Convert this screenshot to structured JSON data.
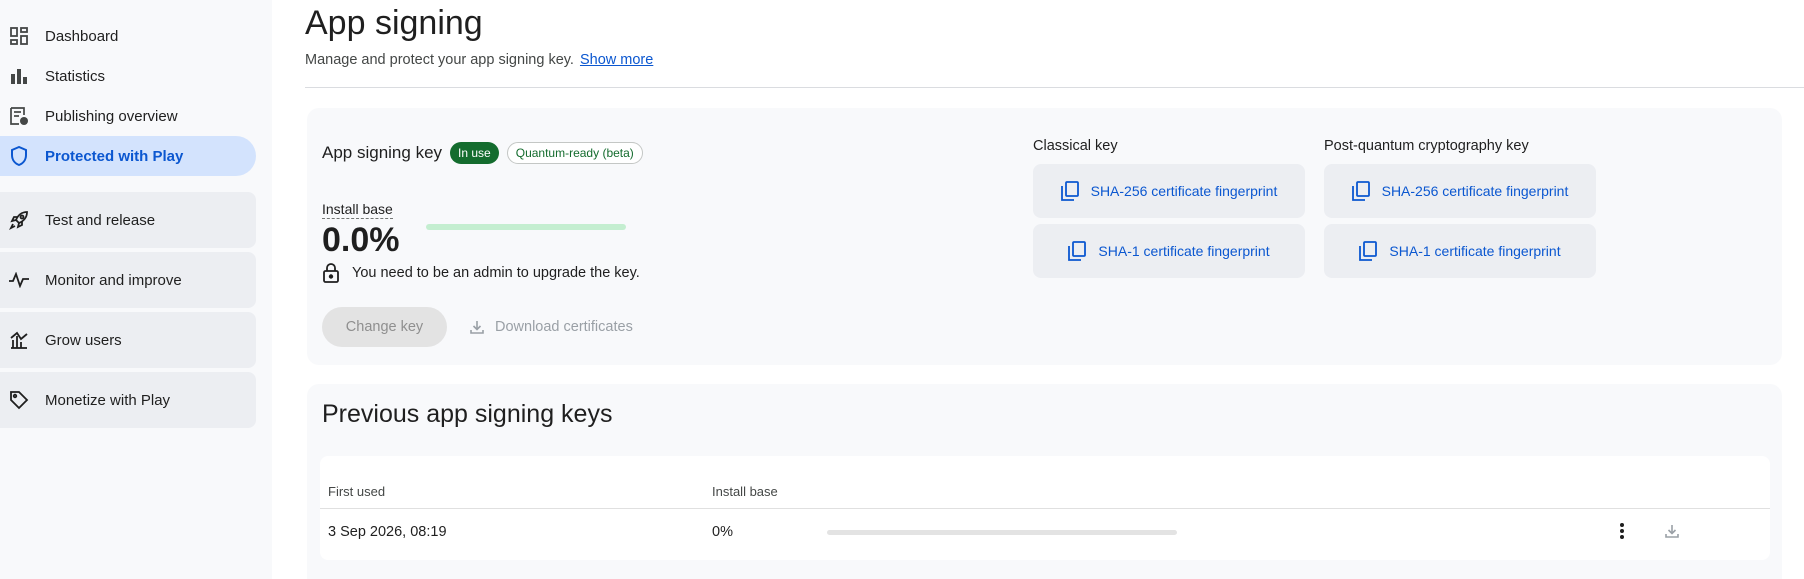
{
  "sidebar": {
    "items": [
      {
        "label": "Dashboard",
        "icon": "dashboard-icon"
      },
      {
        "label": "Statistics",
        "icon": "bar-chart-icon"
      },
      {
        "label": "Publishing overview",
        "icon": "publishing-icon"
      },
      {
        "label": "Protected with Play",
        "icon": "shield-icon",
        "active": true
      }
    ],
    "groups": [
      {
        "label": "Test and release",
        "icon": "rocket-icon"
      },
      {
        "label": "Monitor and improve",
        "icon": "pulse-icon"
      },
      {
        "label": "Grow users",
        "icon": "growth-icon"
      },
      {
        "label": "Monetize with Play",
        "icon": "tag-icon"
      }
    ]
  },
  "header": {
    "title": "App signing",
    "subtitle": "Manage and protect your app signing key.",
    "show_more": "Show more"
  },
  "signing_key": {
    "title": "App signing key",
    "badge_in_use": "In use",
    "badge_quantum": "Quantum-ready (beta)",
    "install_base_label": "Install base",
    "install_base_value": "0.0%",
    "install_base_fraction": 0.0,
    "admin_notice": "You need to be an admin to upgrade the key.",
    "change_key": "Change key",
    "download_certificates": "Download certificates"
  },
  "classical_key": {
    "title": "Classical key",
    "sha256": "SHA-256 certificate fingerprint",
    "sha1": "SHA-1 certificate fingerprint"
  },
  "pq_key": {
    "title": "Post-quantum cryptography key",
    "sha256": "SHA-256 certificate fingerprint",
    "sha1": "SHA-1 certificate fingerprint"
  },
  "previous_keys": {
    "title": "Previous app signing keys",
    "columns": {
      "first_used": "First used",
      "install_base": "Install base"
    },
    "rows": [
      {
        "first_used": "3 Sep 2026, 08:19",
        "install_base": "0%",
        "install_fraction": 0.0
      }
    ]
  },
  "colors": {
    "accent": "#0b57d0",
    "active_nav_bg": "#d3e3fd",
    "in_use_badge": "#146c2e"
  }
}
